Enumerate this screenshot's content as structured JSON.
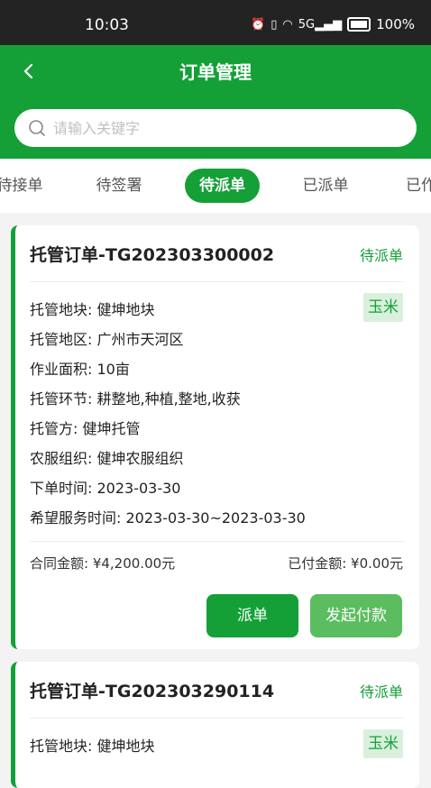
{
  "status_bar": {
    "time": "10:03",
    "battery": "100%",
    "signal": "5G"
  },
  "header": {
    "title": "订单管理",
    "search_placeholder": "请输入关键字"
  },
  "tabs": [
    {
      "label": "待接单",
      "active": false
    },
    {
      "label": "待签署",
      "active": false
    },
    {
      "label": "待派单",
      "active": true
    },
    {
      "label": "已派单",
      "active": false
    },
    {
      "label": "已作",
      "active": false
    }
  ],
  "orders": [
    {
      "title": "托管订单-TG202303300002",
      "status": "待派单",
      "crop": "玉米",
      "fields": [
        "托管地块: 健坤地块",
        "托管地区: 广州市天河区",
        "作业面积: 10亩",
        "托管环节: 耕整地,种植,整地,收获",
        "托管方: 健坤托管",
        "农服组织: 健坤农服组织",
        "下单时间: 2023-03-30",
        "希望服务时间: 2023-03-30~2023-03-30"
      ],
      "contract_amount": "合同金额:  ¥4,200.00元",
      "paid_amount": "已付金额:  ¥0.00元",
      "dispatch_label": "派单",
      "pay_label": "发起付款"
    },
    {
      "title": "托管订单-TG202303290114",
      "status": "待派单",
      "crop": "玉米",
      "fields": [
        "托管地块: 健坤地块"
      ]
    }
  ],
  "colors": {
    "primary": "#14a037",
    "primary_light": "#5bbd5f",
    "tag_bg": "#d9f0dd"
  }
}
